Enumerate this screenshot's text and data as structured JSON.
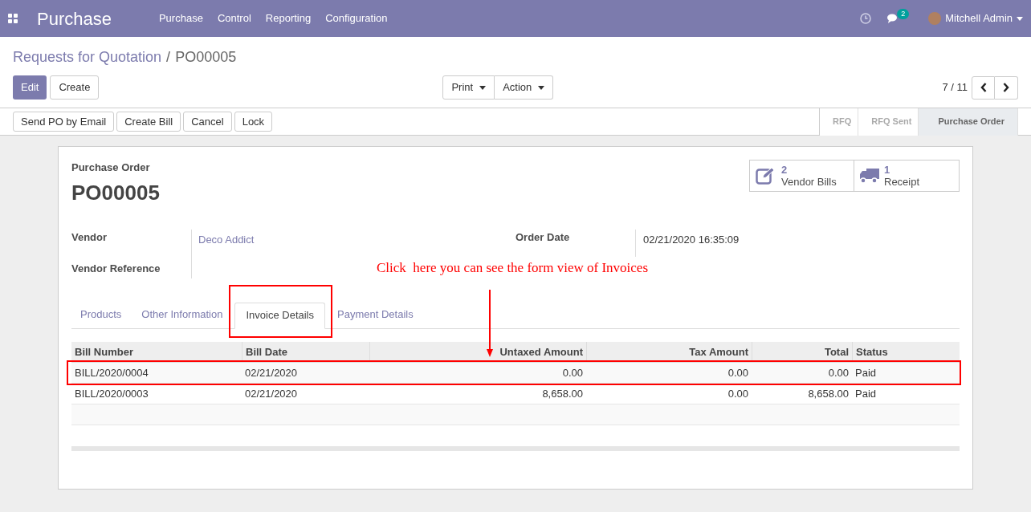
{
  "navbar": {
    "app_title": "Purchase",
    "menu": [
      "Purchase",
      "Control",
      "Reporting",
      "Configuration"
    ],
    "message_count": "2",
    "user": "Mitchell Admin"
  },
  "breadcrumb": {
    "parent": "Requests for Quotation",
    "separator": "/",
    "current": "PO00005"
  },
  "buttons": {
    "edit": "Edit",
    "create": "Create",
    "print": "Print",
    "action": "Action"
  },
  "pager": "7 / 11",
  "header_buttons": [
    "Send PO by Email",
    "Create Bill",
    "Cancel",
    "Lock"
  ],
  "status_steps": [
    {
      "label": "RFQ",
      "selected": false
    },
    {
      "label": "RFQ Sent",
      "selected": false
    },
    {
      "label": "Purchase Order",
      "selected": true
    }
  ],
  "smart_buttons": [
    {
      "kind": "bills",
      "count": "2",
      "label": "Vendor Bills"
    },
    {
      "kind": "receipt",
      "count": "1",
      "label": "Receipt"
    }
  ],
  "form": {
    "doc_type": "Purchase Order",
    "name": "PO00005",
    "vendor_label": "Vendor",
    "vendor": "Deco Addict",
    "vendor_ref_label": "Vendor Reference",
    "order_date_label": "Order Date",
    "order_date": "02/21/2020 16:35:09"
  },
  "tabs": [
    {
      "label": "Products",
      "selected": false
    },
    {
      "label": "Other Information",
      "selected": false
    },
    {
      "label": "Invoice Details",
      "selected": true
    },
    {
      "label": "Payment Details",
      "selected": false
    }
  ],
  "table": {
    "columns": [
      "Bill Number",
      "Bill Date",
      "Untaxed Amount",
      "Tax Amount",
      "Total",
      "Status"
    ],
    "rows": [
      [
        "BILL/2020/0004",
        "02/21/2020",
        "0.00",
        "0.00",
        "0.00",
        "Paid"
      ],
      [
        "BILL/2020/0003",
        "02/21/2020",
        "8,658.00",
        "0.00",
        "8,658.00",
        "Paid"
      ]
    ]
  },
  "annotation": {
    "text": "Click  here you can see the form view of Invoices"
  }
}
